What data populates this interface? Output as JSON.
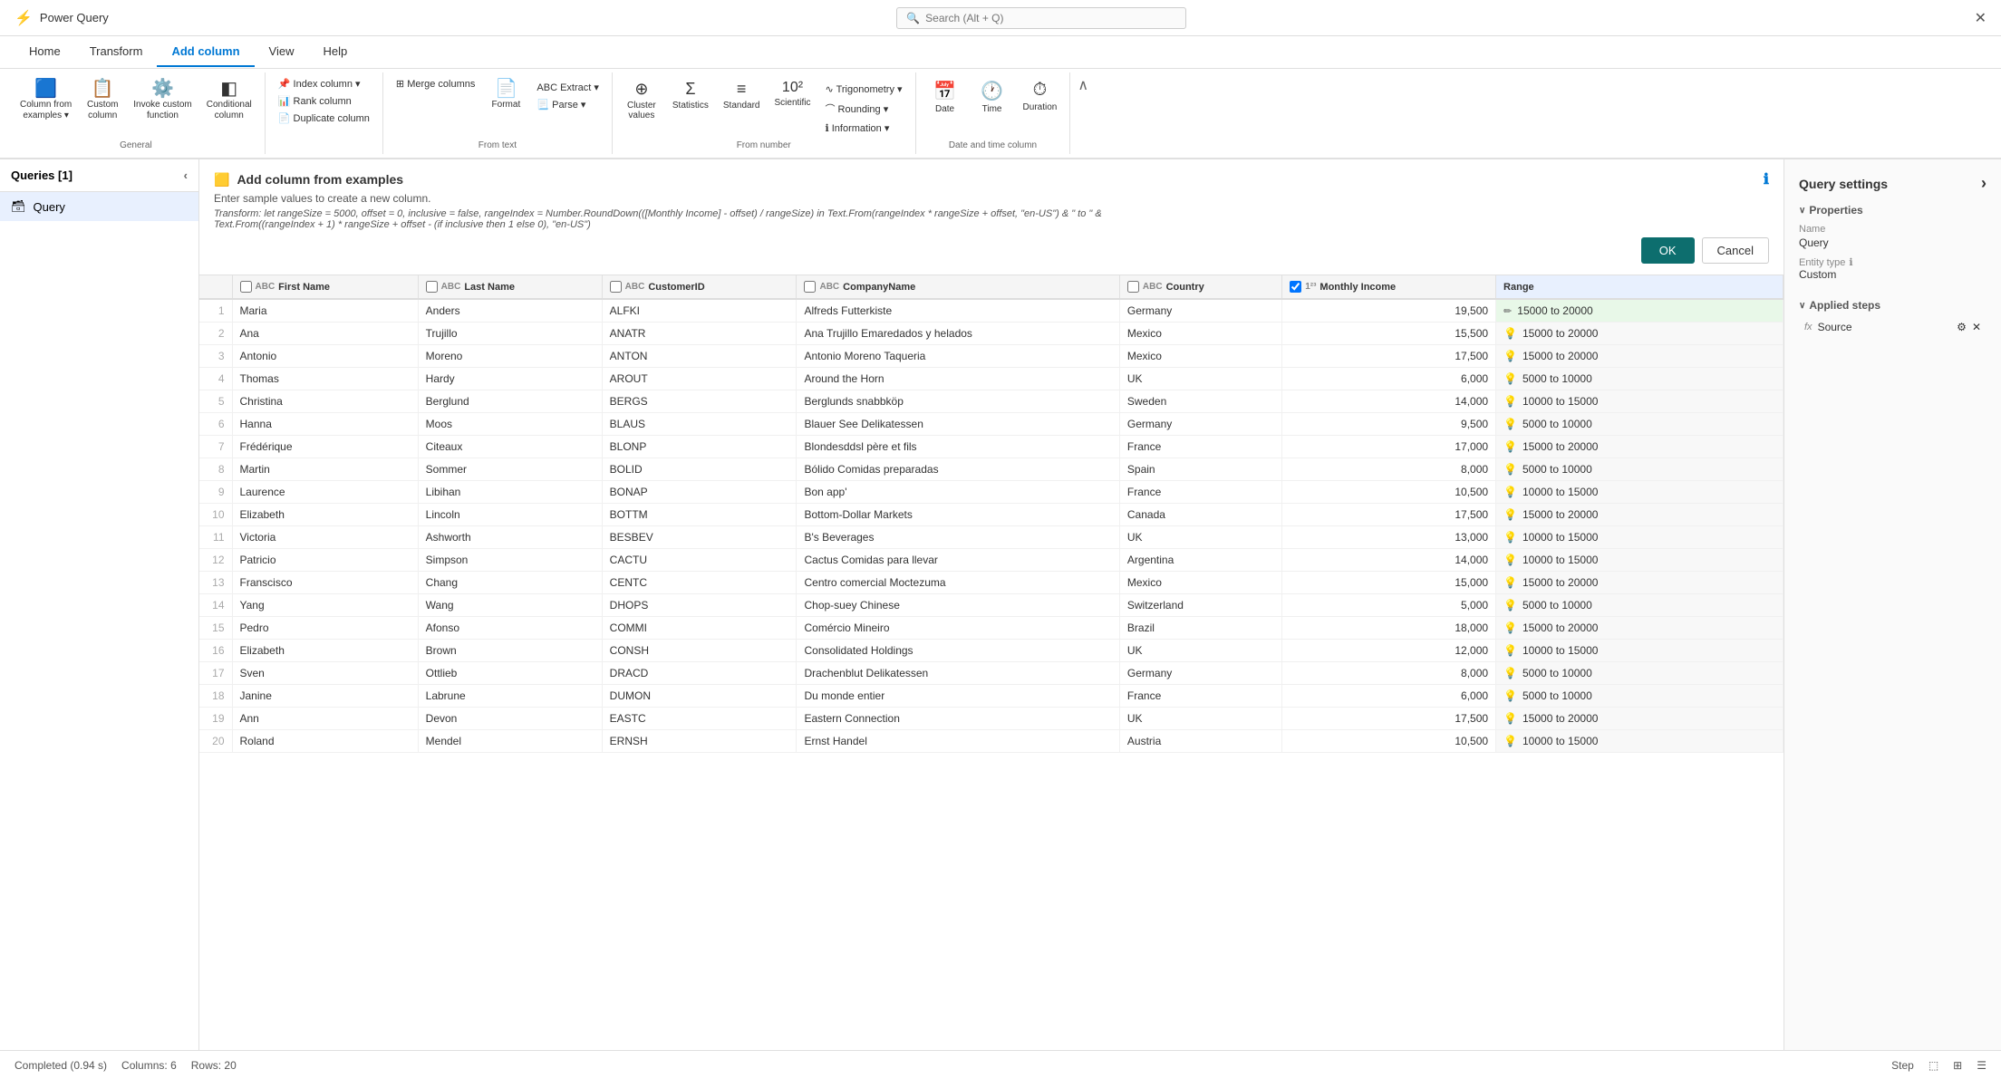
{
  "app": {
    "title": "Power Query",
    "close_icon": "✕"
  },
  "search": {
    "placeholder": "Search (Alt + Q)"
  },
  "ribbon_tabs": [
    {
      "label": "Home",
      "active": false
    },
    {
      "label": "Transform",
      "active": false
    },
    {
      "label": "Add column",
      "active": true
    },
    {
      "label": "View",
      "active": false
    },
    {
      "label": "Help",
      "active": false
    }
  ],
  "ribbon": {
    "groups": [
      {
        "label": "General",
        "items_type": "large",
        "items": [
          {
            "icon": "🟦",
            "label": "Column from\nexamples",
            "has_arrow": true
          },
          {
            "icon": "📋",
            "label": "Custom\ncolumn"
          },
          {
            "icon": "⚙️",
            "label": "Invoke custom\nfunction"
          },
          {
            "icon": "◧",
            "label": "Conditional\ncolumn"
          }
        ]
      },
      {
        "label": "",
        "items_type": "small_col",
        "items": [
          {
            "label": "Index column",
            "has_arrow": true
          },
          {
            "label": "Rank column"
          },
          {
            "label": "Duplicate column"
          }
        ]
      },
      {
        "label": "From text",
        "items_type": "large_and_small",
        "large": [
          {
            "icon": "📄",
            "label": "Format"
          }
        ],
        "small_col": [
          {
            "label": "Extract",
            "has_arrow": true
          },
          {
            "label": "Parse",
            "has_arrow": true
          }
        ],
        "merge_label": "Merge columns"
      },
      {
        "label": "From number",
        "items_type": "large_and_small",
        "large": [
          {
            "icon": "Σ",
            "label": "Cluster\nvalues"
          },
          {
            "icon": "📊",
            "label": "Statistics"
          },
          {
            "icon": "≡",
            "label": "Standard"
          },
          {
            "icon": "10²",
            "label": "Scientific"
          }
        ],
        "small": [
          {
            "label": "Trigonometry",
            "has_arrow": true
          },
          {
            "label": "Rounding",
            "has_arrow": true
          },
          {
            "label": "Information",
            "has_arrow": true
          }
        ]
      },
      {
        "label": "Date and time column",
        "items_type": "large",
        "items": [
          {
            "icon": "📅",
            "label": "Date"
          },
          {
            "icon": "🕐",
            "label": "Time"
          },
          {
            "icon": "⏱",
            "label": "Duration"
          }
        ]
      }
    ]
  },
  "sidebar": {
    "title": "Queries [1]",
    "items": [
      {
        "label": "Query",
        "icon": "🗃",
        "active": true
      }
    ]
  },
  "add_col_panel": {
    "icon": "🟨",
    "title": "Add column from examples",
    "subtitle": "Enter sample values to create a new column.",
    "formula": "Transform: let rangeSize = 5000, offset = 0, inclusive = false, rangeIndex = Number.RoundDown(([Monthly Income] - offset) / rangeSize) in Text.From(rangeIndex * rangeSize + offset, \"en-US\") & \" to \" & Text.From((rangeIndex + 1) * rangeSize + offset - (if inclusive then 1 else 0), \"en-US\")",
    "ok_label": "OK",
    "cancel_label": "Cancel",
    "help_icon": "ℹ"
  },
  "table": {
    "columns": [
      {
        "label": "",
        "type": "row_num"
      },
      {
        "label": "First Name",
        "type": "text",
        "icon": "ABC"
      },
      {
        "label": "Last Name",
        "type": "text",
        "icon": "ABC"
      },
      {
        "label": "CustomerID",
        "type": "text",
        "icon": "ABC"
      },
      {
        "label": "CompanyName",
        "type": "text",
        "icon": "ABC"
      },
      {
        "label": "Country",
        "type": "text",
        "icon": "ABC"
      },
      {
        "label": "Monthly Income",
        "type": "number",
        "icon": "123",
        "checked": true
      },
      {
        "label": "Range",
        "type": "range",
        "highlight": true
      }
    ],
    "rows": [
      {
        "num": 1,
        "first": "Maria",
        "last": "Anders",
        "id": "ALFKI",
        "company": "Alfreds Futterkiste",
        "country": "Germany",
        "income": 19500,
        "range": "15000 to 20000",
        "editing": true
      },
      {
        "num": 2,
        "first": "Ana",
        "last": "Trujillo",
        "id": "ANATR",
        "company": "Ana Trujillo Emaredados y helados",
        "country": "Mexico",
        "income": 15500,
        "range": "15000 to 20000"
      },
      {
        "num": 3,
        "first": "Antonio",
        "last": "Moreno",
        "id": "ANTON",
        "company": "Antonio Moreno Taqueria",
        "country": "Mexico",
        "income": 17500,
        "range": "15000 to 20000"
      },
      {
        "num": 4,
        "first": "Thomas",
        "last": "Hardy",
        "id": "AROUT",
        "company": "Around the Horn",
        "country": "UK",
        "income": 6000,
        "range": "5000 to 10000"
      },
      {
        "num": 5,
        "first": "Christina",
        "last": "Berglund",
        "id": "BERGS",
        "company": "Berglunds snabbköp",
        "country": "Sweden",
        "income": 14000,
        "range": "10000 to 15000"
      },
      {
        "num": 6,
        "first": "Hanna",
        "last": "Moos",
        "id": "BLAUS",
        "company": "Blauer See Delikatessen",
        "country": "Germany",
        "income": 9500,
        "range": "5000 to 10000"
      },
      {
        "num": 7,
        "first": "Frédérique",
        "last": "Citeaux",
        "id": "BLONP",
        "company": "Blondesddsl père et fils",
        "country": "France",
        "income": 17000,
        "range": "15000 to 20000"
      },
      {
        "num": 8,
        "first": "Martin",
        "last": "Sommer",
        "id": "BOLID",
        "company": "Bólido Comidas preparadas",
        "country": "Spain",
        "income": 8000,
        "range": "5000 to 10000"
      },
      {
        "num": 9,
        "first": "Laurence",
        "last": "Libihan",
        "id": "BONAP",
        "company": "Bon app'",
        "country": "France",
        "income": 10500,
        "range": "10000 to 15000"
      },
      {
        "num": 10,
        "first": "Elizabeth",
        "last": "Lincoln",
        "id": "BOTTM",
        "company": "Bottom-Dollar Markets",
        "country": "Canada",
        "income": 17500,
        "range": "15000 to 20000"
      },
      {
        "num": 11,
        "first": "Victoria",
        "last": "Ashworth",
        "id": "BESBEV",
        "company": "B's Beverages",
        "country": "UK",
        "income": 13000,
        "range": "10000 to 15000"
      },
      {
        "num": 12,
        "first": "Patricio",
        "last": "Simpson",
        "id": "CACTU",
        "company": "Cactus Comidas para llevar",
        "country": "Argentina",
        "income": 14000,
        "range": "10000 to 15000"
      },
      {
        "num": 13,
        "first": "Franscisco",
        "last": "Chang",
        "id": "CENTC",
        "company": "Centro comercial Moctezuma",
        "country": "Mexico",
        "income": 15000,
        "range": "15000 to 20000"
      },
      {
        "num": 14,
        "first": "Yang",
        "last": "Wang",
        "id": "DHOPS",
        "company": "Chop-suey Chinese",
        "country": "Switzerland",
        "income": 5000,
        "range": "5000 to 10000"
      },
      {
        "num": 15,
        "first": "Pedro",
        "last": "Afonso",
        "id": "COMMI",
        "company": "Comércio Mineiro",
        "country": "Brazil",
        "income": 18000,
        "range": "15000 to 20000"
      },
      {
        "num": 16,
        "first": "Elizabeth",
        "last": "Brown",
        "id": "CONSH",
        "company": "Consolidated Holdings",
        "country": "UK",
        "income": 12000,
        "range": "10000 to 15000"
      },
      {
        "num": 17,
        "first": "Sven",
        "last": "Ottlieb",
        "id": "DRACD",
        "company": "Drachenblut Delikatessen",
        "country": "Germany",
        "income": 8000,
        "range": "5000 to 10000"
      },
      {
        "num": 18,
        "first": "Janine",
        "last": "Labrune",
        "id": "DUMON",
        "company": "Du monde entier",
        "country": "France",
        "income": 6000,
        "range": "5000 to 10000"
      },
      {
        "num": 19,
        "first": "Ann",
        "last": "Devon",
        "id": "EASTC",
        "company": "Eastern Connection",
        "country": "UK",
        "income": 17500,
        "range": "15000 to 20000"
      },
      {
        "num": 20,
        "first": "Roland",
        "last": "Mendel",
        "id": "ERNSH",
        "company": "Ernst Handel",
        "country": "Austria",
        "income": 10500,
        "range": "10000 to 15000"
      }
    ]
  },
  "query_settings": {
    "title": "Query settings",
    "expand_icon": "›",
    "properties_label": "∨ Properties",
    "name_label": "Name",
    "name_value": "Query",
    "entity_type_label": "Entity type",
    "entity_type_info": "ℹ",
    "entity_type_value": "Custom",
    "applied_steps_label": "∨ Applied steps",
    "steps": [
      {
        "fx": "fx",
        "label": "Source",
        "has_settings": true
      }
    ]
  },
  "status_bar": {
    "status": "Completed (0.94 s)",
    "columns": "Columns: 6",
    "rows": "Rows: 20",
    "step_label": "Step",
    "icons": [
      "⬚",
      "⊞",
      "☰"
    ]
  }
}
